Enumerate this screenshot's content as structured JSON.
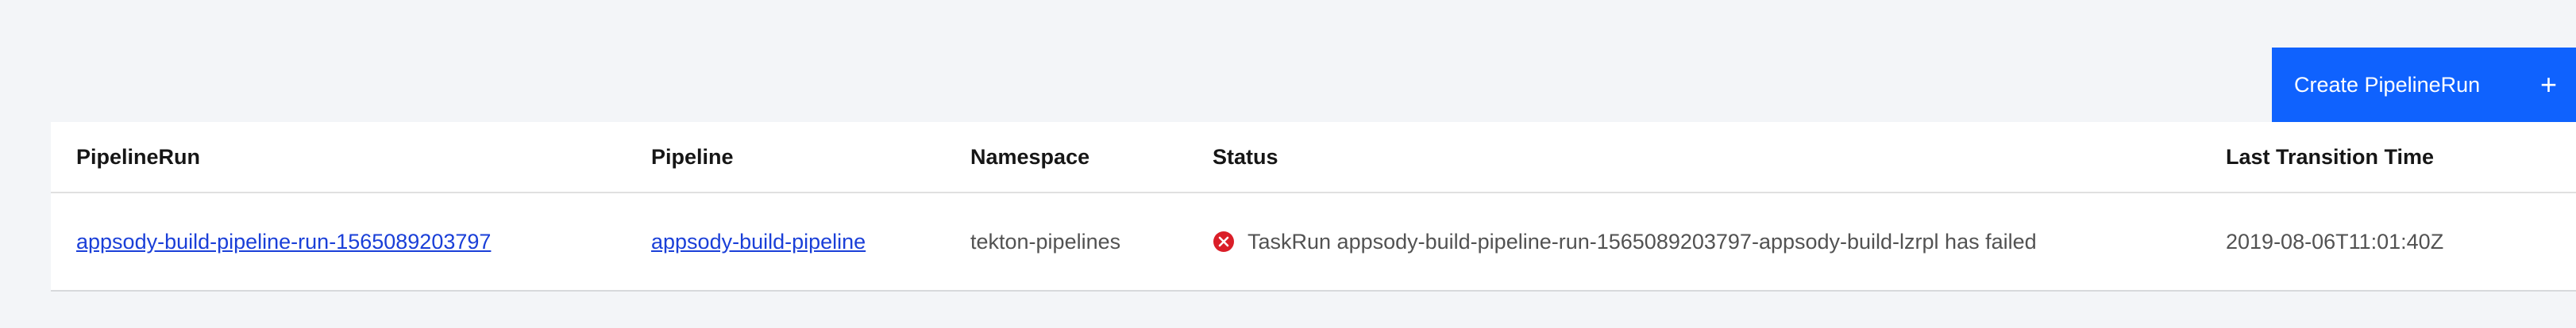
{
  "toolbar": {
    "create_label": "Create PipelineRun",
    "create_icon": "plus-icon"
  },
  "table": {
    "headers": [
      "PipelineRun",
      "Pipeline",
      "Namespace",
      "Status",
      "Last Transition Time"
    ],
    "rows": [
      {
        "pipelinerun": "appsody-build-pipeline-run-1565089203797",
        "pipeline": "appsody-build-pipeline",
        "namespace": "tekton-pipelines",
        "status_icon": "error-icon",
        "status": "TaskRun appsody-build-pipeline-run-1565089203797-appsody-build-lzrpl has failed",
        "last_transition_time": "2019-08-06T11:01:40Z"
      }
    ]
  },
  "colors": {
    "background": "#f3f5f8",
    "primary_button": "#0f62fe",
    "link": "#1a3fd8",
    "error": "#da1e28"
  }
}
